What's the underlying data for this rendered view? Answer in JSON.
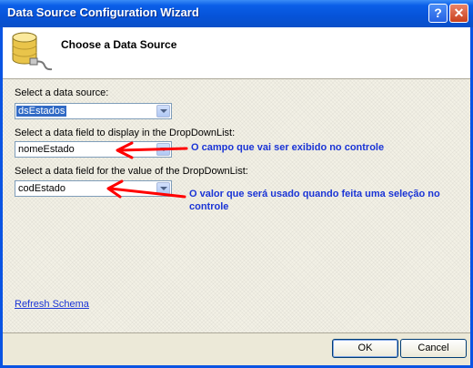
{
  "window": {
    "title": "Data Source Configuration Wizard",
    "help_label": "?",
    "close_label": "✕"
  },
  "header": {
    "title": "Choose a Data Source",
    "icon": "database-icon"
  },
  "form": {
    "datasource_label": "Select a data source:",
    "datasource_value": "dsEstados",
    "display_field_label": "Select a data field to display in the DropDownList:",
    "display_field_value": "nomeEstado",
    "value_field_label": "Select a data field for the value of the DropDownList:",
    "value_field_value": "codEstado"
  },
  "annotations": {
    "display_note": "O campo que vai ser exibido no controle",
    "value_note_line1": "O valor que será usado quando feita uma seleção no",
    "value_note_line2": "controle",
    "arrow_color": "#ff0000"
  },
  "links": {
    "refresh_schema": "Refresh Schema"
  },
  "buttons": {
    "ok": "OK",
    "cancel": "Cancel"
  },
  "colors": {
    "title_bar": "#0a5ee8",
    "annotation_text": "#1a34d6",
    "selection": "#316ac5"
  }
}
